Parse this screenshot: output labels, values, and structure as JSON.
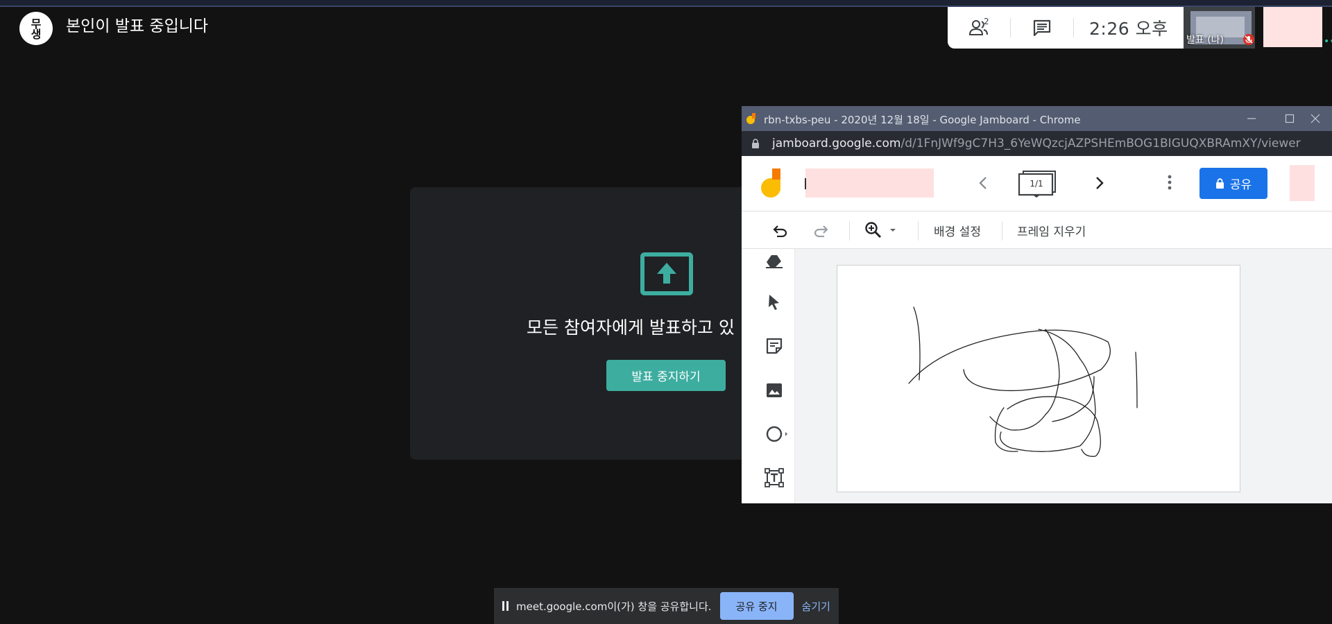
{
  "banner": {
    "avatar_text": "무\n생",
    "title": "본인이 발표 중입니다"
  },
  "meet": {
    "people_count": "2",
    "time": "2:26 오후",
    "self_tile_label": "발표 (나)"
  },
  "presenting": {
    "message": "모든 참여자에게 발표하고 있",
    "stop_button": "발표 중지하기"
  },
  "chrome": {
    "window_title": "rbn-txbs-peu - 2020년 12월 18일 - Google Jamboard - Chrome",
    "url_host": "jamboard.google.com",
    "url_path": "/d/1FnJWf9gC7H3_6YeWQzcjAZPSHEmBOG1BIGUQXBRAmXY/viewer"
  },
  "jamboard": {
    "frame_indicator": "1/1",
    "share_button": "공유",
    "background_button": "배경 설정",
    "clear_frame_button": "프레임 지우기"
  },
  "share_notice": {
    "text": "meet.google.com이(가) 창을 공유합니다.",
    "stop_button": "공유 중지",
    "hide_link": "숨기기"
  },
  "colors": {
    "accent_teal": "#3dada0",
    "share_blue": "#1a73e8",
    "notice_blue": "#8ab4f8",
    "background": "#121212"
  }
}
